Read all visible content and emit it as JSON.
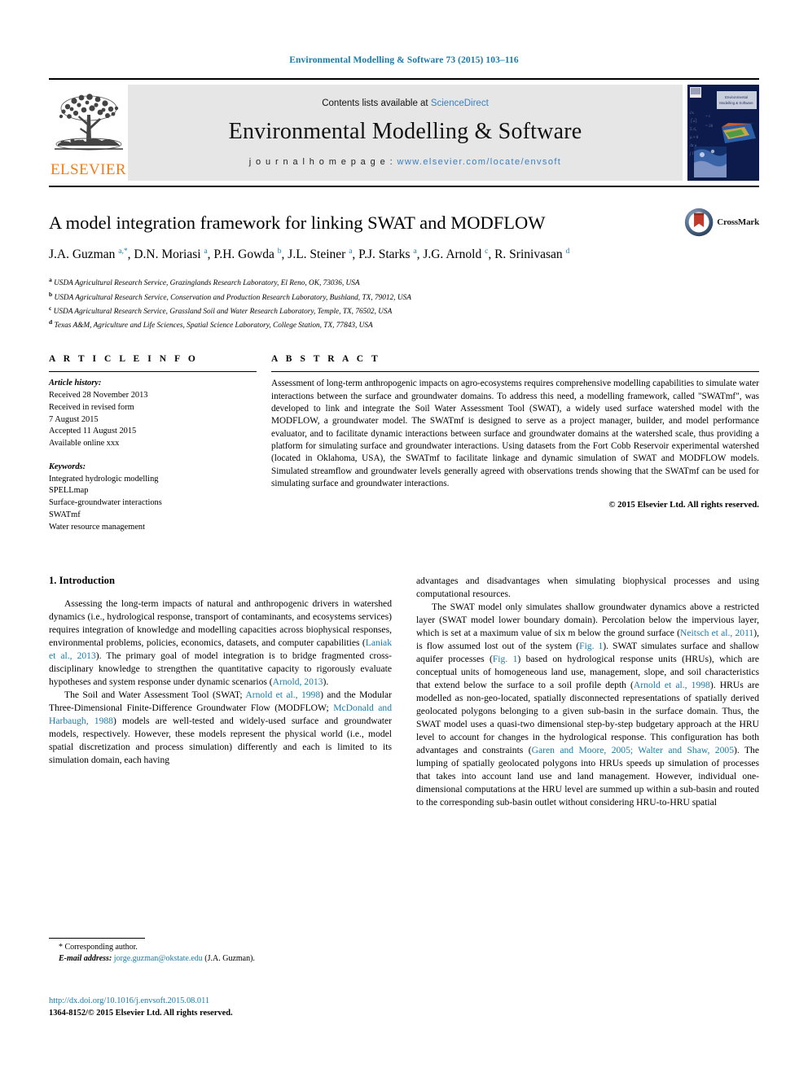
{
  "running_head": "Environmental Modelling & Software 73 (2015) 103–116",
  "banner": {
    "publisher": "ELSEVIER",
    "contents_prefix": "Contents lists available at ",
    "contents_link": "ScienceDirect",
    "journal_title": "Environmental Modelling & Software",
    "homepage_prefix": "j o u r n a l   h o m e p a g e :  ",
    "homepage_url": "www.elsevier.com/locate/envsoft",
    "cover_title": "Environmental Modelling & Software",
    "link_color": "#3a7fc1"
  },
  "crossmark": {
    "label": "CrossMark"
  },
  "paper": {
    "title": "A model integration framework for linking SWAT and MODFLOW",
    "authors_line1": "J.A. Guzman ",
    "authors_full": "J.A. Guzman a,*, D.N. Moriasi a, P.H. Gowda b, J.L. Steiner a, P.J. Starks a, J.G. Arnold c, R. Srinivasan d",
    "authors": [
      {
        "name": "J.A. Guzman",
        "marks": "a,*"
      },
      {
        "name": "D.N. Moriasi",
        "marks": "a"
      },
      {
        "name": "P.H. Gowda",
        "marks": "b"
      },
      {
        "name": "J.L. Steiner",
        "marks": "a"
      },
      {
        "name": "P.J. Starks",
        "marks": "a"
      },
      {
        "name": "J.G. Arnold",
        "marks": "c"
      },
      {
        "name": "R. Srinivasan",
        "marks": "d"
      }
    ],
    "affiliations": [
      {
        "mark": "a",
        "text": "USDA Agricultural Research Service, Grazinglands Research Laboratory, El Reno, OK, 73036, USA"
      },
      {
        "mark": "b",
        "text": "USDA Agricultural Research Service, Conservation and Production Research Laboratory, Bushland, TX, 79012, USA"
      },
      {
        "mark": "c",
        "text": "USDA Agricultural Research Service, Grassland Soil and Water Research Laboratory, Temple, TX, 76502, USA"
      },
      {
        "mark": "d",
        "text": "Texas A&M, Agriculture and Life Sciences, Spatial Science Laboratory, College Station, TX, 77843, USA"
      }
    ]
  },
  "article_info": {
    "heading": "A R T I C L E   I N F O",
    "history_label": "Article history:",
    "history": [
      "Received 28 November 2013",
      "Received in revised form",
      "7 August 2015",
      "Accepted 11 August 2015",
      "Available online xxx"
    ],
    "keywords_label": "Keywords:",
    "keywords": [
      "Integrated hydrologic modelling",
      "SPELLmap",
      "Surface-groundwater interactions",
      "SWATmf",
      "Water resource management"
    ]
  },
  "abstract": {
    "heading": "A B S T R A C T",
    "text": "Assessment of long-term anthropogenic impacts on agro-ecosystems requires comprehensive modelling capabilities to simulate water interactions between the surface and groundwater domains. To address this need, a modelling framework, called \"SWATmf\", was developed to link and integrate the Soil Water Assessment Tool (SWAT), a widely used surface watershed model with the MODFLOW, a groundwater model. The SWATmf is designed to serve as a project manager, builder, and model performance evaluator, and to facilitate dynamic interactions between surface and groundwater domains at the watershed scale, thus providing a platform for simulating surface and groundwater interactions. Using datasets from the Fort Cobb Reservoir experimental watershed (located in Oklahoma, USA), the SWATmf to facilitate linkage and dynamic simulation of SWAT and MODFLOW models. Simulated streamflow and groundwater levels generally agreed with observations trends showing that the SWATmf can be used for simulating surface and groundwater interactions.",
    "copyright": "© 2015 Elsevier Ltd. All rights reserved."
  },
  "body": {
    "section_title": "1. Introduction",
    "left_paragraphs": [
      {
        "segments": [
          {
            "t": "Assessing the long-term impacts of natural and anthropogenic drivers in watershed dynamics (i.e., hydrological response, transport of contaminants, and ecosystems services) requires integration of knowledge and modelling capacities across biophysical responses, environmental problems, policies, economics, datasets, and computer capabilities (",
            "link": false
          },
          {
            "t": "Laniak et al., 2013",
            "link": true
          },
          {
            "t": "). The primary goal of model integration is to bridge fragmented cross-disciplinary knowledge to strengthen the quantitative capacity to rigorously evaluate hypotheses and system response under dynamic scenarios (",
            "link": false
          },
          {
            "t": "Arnold, 2013",
            "link": true
          },
          {
            "t": ").",
            "link": false
          }
        ]
      },
      {
        "segments": [
          {
            "t": "The Soil and Water Assessment Tool (SWAT; ",
            "link": false
          },
          {
            "t": "Arnold et al., 1998",
            "link": true
          },
          {
            "t": ") and the Modular Three-Dimensional Finite-Difference Groundwater Flow (MODFLOW; ",
            "link": false
          },
          {
            "t": "McDonald and Harbaugh, 1988",
            "link": true
          },
          {
            "t": ") models are well-tested and widely-used surface and groundwater models, respectively. However, these models represent the physical world (i.e., model spatial discretization and process simulation) differently and each is limited to its simulation domain, each having",
            "link": false
          }
        ]
      }
    ],
    "right_paragraphs": [
      {
        "segments": [
          {
            "t": "advantages and disadvantages when simulating biophysical processes and using computational resources.",
            "link": false
          }
        ],
        "indent": false
      },
      {
        "segments": [
          {
            "t": "The SWAT model only simulates shallow groundwater dynamics above a restricted layer (SWAT model lower boundary domain). Percolation below the impervious layer, which is set at a maximum value of six m below the ground surface (",
            "link": false
          },
          {
            "t": "Neitsch et al., 2011",
            "link": true
          },
          {
            "t": "), is flow assumed lost out of the system (",
            "link": false
          },
          {
            "t": "Fig. 1",
            "link": true
          },
          {
            "t": "). SWAT simulates surface and shallow aquifer processes (",
            "link": false
          },
          {
            "t": "Fig. 1",
            "link": true
          },
          {
            "t": ") based on hydrological response units (HRUs), which are conceptual units of homogeneous land use, management, slope, and soil characteristics that extend below the surface to a soil profile depth (",
            "link": false
          },
          {
            "t": "Arnold et al., 1998",
            "link": true
          },
          {
            "t": "). HRUs are modelled as non-geo-located, spatially disconnected representations of spatially derived geolocated polygons belonging to a given sub-basin in the surface domain. Thus, the SWAT model uses a quasi-two dimensional step-by-step budgetary approach at the HRU level to account for changes in the hydrological response. This configuration has both advantages and constraints (",
            "link": false
          },
          {
            "t": "Garen and Moore, 2005; Walter and Shaw, 2005",
            "link": true
          },
          {
            "t": "). The lumping of spatially geolocated polygons into HRUs speeds up simulation of processes that takes into account land use and land management. However, individual one-dimensional computations at the HRU level are summed up within a sub-basin and routed to the corresponding sub-basin outlet without considering HRU-to-HRU spatial",
            "link": false
          }
        ],
        "indent": true
      }
    ]
  },
  "footnote": {
    "corresponding_mark": "*",
    "corresponding_label": "Corresponding author.",
    "email_label": "E-mail address:",
    "email": "jorge.guzman@okstate.edu",
    "email_owner": "(J.A. Guzman)."
  },
  "doi": {
    "url": "http://dx.doi.org/10.1016/j.envsoft.2015.08.011",
    "issn": "1364-8152/© 2015 Elsevier Ltd. All rights reserved."
  }
}
